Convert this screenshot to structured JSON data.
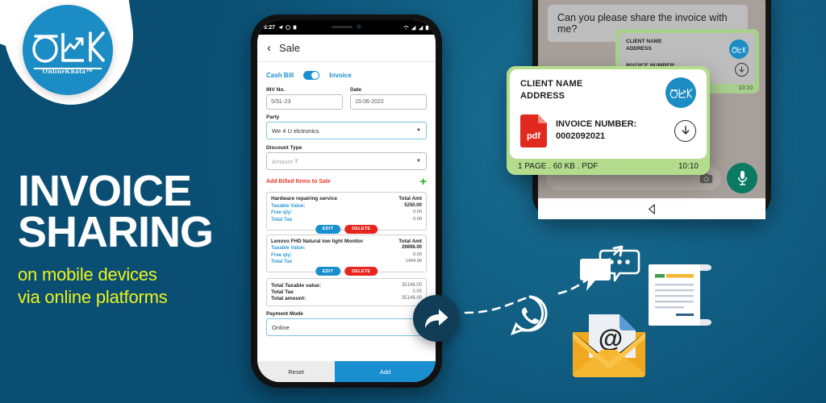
{
  "brand": {
    "logo_letters": "OLK",
    "logo_name": "OnlineKhata",
    "logo_tm": "™"
  },
  "headline": {
    "line1": "INVOICE",
    "line2": "SHARING",
    "sub1": "on mobile devices",
    "sub2": "via online platforms"
  },
  "colors": {
    "background_dark": "#0b4f70",
    "background_light": "#1a7a9e",
    "brand_blue": "#1b8cc4",
    "accent_yellow": "#eef31c",
    "danger_red": "#e8241f",
    "success_green": "#24b324",
    "whatsapp_green": "#0b7a62",
    "bubble_green": "#a9cf8f"
  },
  "phone_sale": {
    "status_bar": {
      "time": "5:27"
    },
    "appbar": {
      "back": "‹",
      "title": "Sale"
    },
    "toggle": {
      "left_label": "Cash Bill",
      "right_label": "Invoice",
      "state": "on"
    },
    "fields": {
      "inv_no_label": "INV No.",
      "inv_no_value": "5/SL-23",
      "date_label": "Date",
      "date_value": "15-06-2022",
      "party_label": "Party",
      "party_value": "We 4 U elctronics",
      "discount_label": "Discount Type",
      "discount_placeholder": "Amount ₹",
      "payment_label": "Payment Mode",
      "payment_value": "Online"
    },
    "add_items": {
      "label": "Add Billed Items to Sale",
      "icon": "plus-icon"
    },
    "items": [
      {
        "title": "Hardware repairing service",
        "amount_label": "Total Amt",
        "taxable_label": "Taxable Value:",
        "taxable_value": "5250.00",
        "freeqty_label": "Free qty:",
        "freeqty_value": "0.00",
        "tax_label": "Total Tax",
        "tax_value": "0.00",
        "edit": "EDIT",
        "delete": "DELETE"
      },
      {
        "title": "Lenovo FHD Natural low light Monitor",
        "amount_label": "Total Amt",
        "taxable_label": "Taxable Value:",
        "taxable_value": "29898.00",
        "freeqty_label": "Free qty:",
        "freeqty_value": "0.00",
        "tax_label": "Total Tax",
        "tax_value": "1494.90",
        "edit": "EDIT",
        "delete": "DELETE"
      }
    ],
    "totals": [
      {
        "key": "Total Taxable value:",
        "value": "35148.00"
      },
      {
        "key": "Total Tax",
        "value": "0.00"
      },
      {
        "key": "Total amount:",
        "value": "35148.00"
      }
    ],
    "buttons": {
      "reset": "Reset",
      "add": "Add"
    }
  },
  "phone_chat": {
    "incoming_message": "Can you please share the invoice with me?",
    "attachment_preview": {
      "client_name": "CLIENT NAME",
      "address": "ADDRESS",
      "invoice_label": "INVOICE NUMBER:",
      "invoice_number": "0002092021"
    },
    "message_time": "10:10"
  },
  "float_card": {
    "client_name": "CLIENT NAME",
    "address": "ADDRESS",
    "pdf_badge": "pdf",
    "invoice_label": "INVOICE NUMBER:",
    "invoice_number": "0002092021",
    "footer_meta": "1 PAGE . 60 KB . PDF",
    "footer_time": "10:10"
  }
}
